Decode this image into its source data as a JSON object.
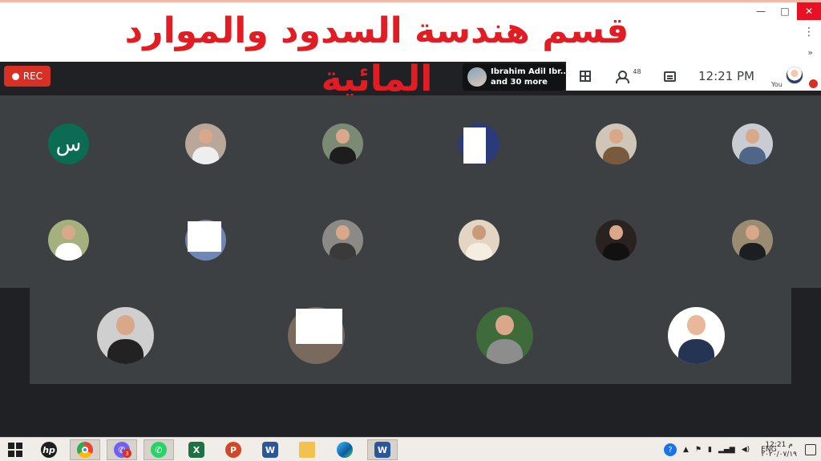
{
  "banner": {
    "title": "قسم هندسة السدود والموارد المائية"
  },
  "window": {
    "minimize": "—",
    "maximize": "□",
    "close": "✕",
    "menu": "⋮",
    "more": "»"
  },
  "rec": {
    "label": "REC"
  },
  "presenter": {
    "name": "Ibrahim Adil Ibr...",
    "more": "and 30 more"
  },
  "topbar": {
    "participants_count": "48",
    "time": "12:21  PM",
    "you_label": "You"
  },
  "tiles": {
    "initial_letter": "س"
  },
  "taskbar": {
    "apps": [
      "windows-start",
      "hp",
      "chrome",
      "viber",
      "whatsapp",
      "excel",
      "powerpoint",
      "word",
      "file-explorer",
      "edge",
      "word-active"
    ],
    "viber_badge": "3",
    "language": "ENG",
    "clock_time": "12:21 م",
    "clock_date": "٢٠٢٠/٠٧/١٩"
  },
  "colors": {
    "accent": "#d93025",
    "title_red": "#e21c23",
    "tile_bg": "#3c4043",
    "page_bg": "#202124"
  }
}
